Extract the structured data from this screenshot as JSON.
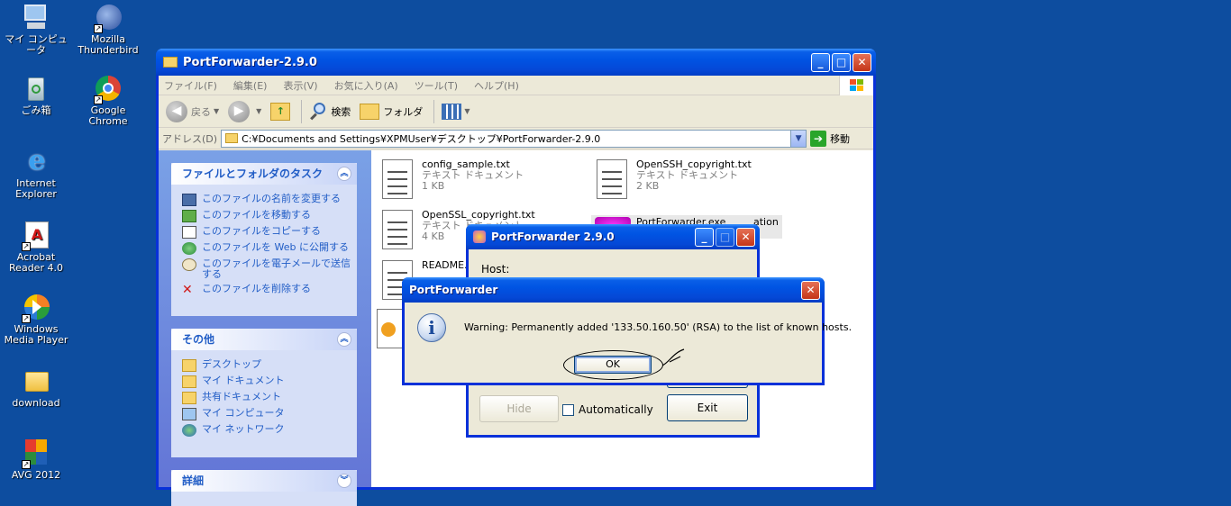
{
  "desktop": {
    "icons": [
      {
        "label": "マイ コンピュータ"
      },
      {
        "label": "Mozilla Thunderbird"
      },
      {
        "label": "ごみ箱"
      },
      {
        "label": "Google Chrome"
      },
      {
        "label": "Internet Explorer"
      },
      {
        "label": "Acrobat Reader 4.0"
      },
      {
        "label": "Windows Media Player"
      },
      {
        "label": "download"
      },
      {
        "label": "AVG 2012"
      }
    ]
  },
  "explorer": {
    "title": "PortForwarder-2.9.0",
    "menu": [
      "ファイル(F)",
      "編集(E)",
      "表示(V)",
      "お気に入り(A)",
      "ツール(T)",
      "ヘルプ(H)"
    ],
    "toolbar": {
      "back": "戻る",
      "search": "検索",
      "folders": "フォルダ"
    },
    "address": {
      "label": "アドレス(D)",
      "path": "C:¥Documents and Settings¥XPMUser¥デスクトップ¥PortForwarder-2.9.0",
      "go": "移動"
    },
    "tasks": {
      "header": "ファイルとフォルダのタスク",
      "items": [
        "このファイルの名前を変更する",
        "このファイルを移動する",
        "このファイルをコピーする",
        "このファイルを Web に公開する",
        "このファイルを電子メールで送信する",
        "このファイルを削除する"
      ]
    },
    "other": {
      "header": "その他",
      "items": [
        "デスクトップ",
        "マイ ドキュメント",
        "共有ドキュメント",
        "マイ コンピュータ",
        "マイ ネットワーク"
      ]
    },
    "details": {
      "header": "詳細"
    },
    "files": [
      {
        "name": "config_sample.txt",
        "type": "テキスト ドキュメント",
        "size": "1 KB"
      },
      {
        "name": "OpenSSH_copyright.txt",
        "type": "テキスト ドキュメント",
        "size": "2 KB"
      },
      {
        "name": "OpenSSL_copyright.txt",
        "type": "テキスト ドキュメント",
        "size": "4 KB"
      },
      {
        "name": "PortForwarder.exe",
        "type": "ation"
      },
      {
        "name": "README.t"
      }
    ]
  },
  "pf_dialog": {
    "title": "PortForwarder 2.9.0",
    "host_label": "Host:",
    "hide_label": "Hide",
    "auto_label": "Automatically",
    "exit_label": "Exit"
  },
  "alert": {
    "title": "PortForwarder",
    "message": "Warning: Permanently added '133.50.160.50' (RSA) to the list of known hosts.",
    "ok_label": "OK"
  },
  "colors": {
    "desktop": "#0d4d9f",
    "titlebar": "#0054e3",
    "task_pane": "#7aa1e6",
    "task_link": "#215dc6"
  }
}
